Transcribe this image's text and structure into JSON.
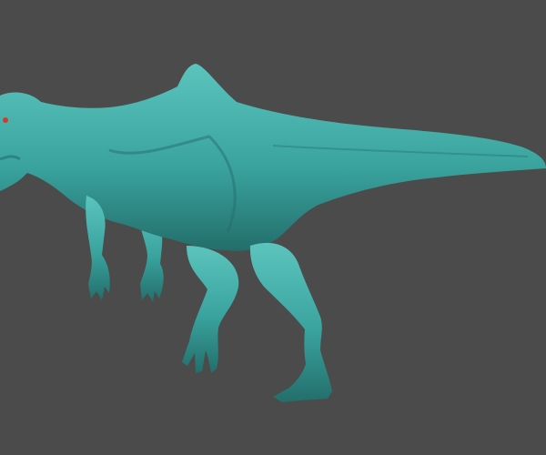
{
  "scene": {
    "subject": "spinosaurus-sculpt",
    "colors": {
      "background": "#4b4b4b",
      "model": "#3aa39e",
      "model_light": "#5cc4bd",
      "model_shadow": "#236e6b",
      "eye": "#d23a2a"
    }
  }
}
